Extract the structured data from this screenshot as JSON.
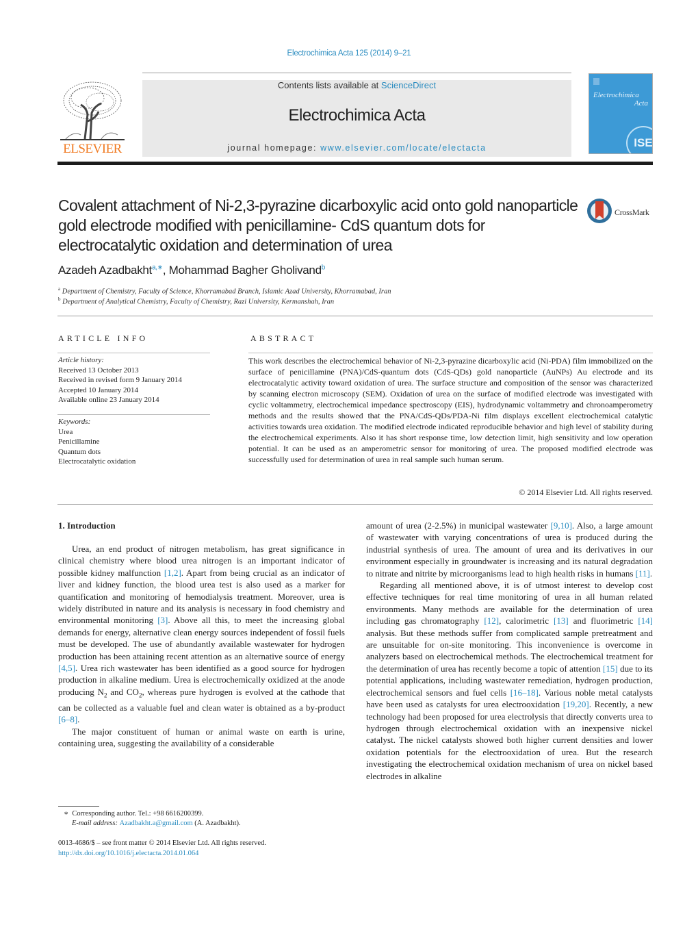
{
  "header": {
    "journal_ref": "Electrochimica Acta 125 (2014) 9–21",
    "contents_prefix": "Contents lists available at ",
    "contents_link": "ScienceDirect",
    "journal_title": "Electrochimica Acta",
    "homepage_prefix": "journal homepage: ",
    "homepage_link": "www.elsevier.com/locate/electacta",
    "publisher_logo": "ELSEVIER",
    "cover": {
      "title_line1": "Electrochimica",
      "title_line2": "Acta",
      "society_badge": "ISE"
    },
    "accent_color": "#2a8cc0",
    "logo_color": "#f07a22",
    "cover_color": "#3d9ad6"
  },
  "article": {
    "title": "Covalent attachment of Ni-2,3-pyrazine dicarboxylic acid onto gold nanoparticle gold electrode modified with penicillamine- CdS quantum dots for electrocatalytic oxidation and determination of urea",
    "crossmark": "CrossMark",
    "authors": [
      {
        "name": "Azadeh Azadbakht",
        "sup": "a,∗"
      },
      {
        "name": "Mohammad Bagher Gholivand",
        "sup": "b"
      }
    ],
    "author_separator": ", ",
    "affiliations": [
      {
        "sup": "a",
        "text": "Department of Chemistry, Faculty of Science, Khorramabad Branch, Islamic Azad University, Khorramabad, Iran"
      },
      {
        "sup": "b",
        "text": "Department of Analytical Chemistry, Faculty of Chemistry, Razi University, Kermanshah, Iran"
      }
    ]
  },
  "article_info": {
    "heading": "ARTICLE INFO",
    "history_label": "Article history:",
    "history": [
      "Received 13 October 2013",
      "Received in revised form 9 January 2014",
      "Accepted 10 January 2014",
      "Available online 23 January 2014"
    ],
    "keywords_label": "Keywords:",
    "keywords": [
      "Urea",
      "Penicillamine",
      "Quantum dots",
      "Electrocatalytic oxidation"
    ]
  },
  "abstract": {
    "heading": "ABSTRACT",
    "text": "This work describes the electrochemical behavior of Ni-2,3-pyrazine dicarboxylic acid (Ni-PDA) film immobilized on the surface of penicillamine (PNA)/CdS-quantum dots (CdS-QDs) gold nanoparticle (AuNPs) Au electrode and its electrocatalytic activity toward oxidation of urea. The surface structure and composition of the sensor was characterized by scanning electron microscopy (SEM). Oxidation of urea on the surface of modified electrode was investigated with cyclic voltammetry, electrochemical impedance spectroscopy (EIS), hydrodynamic voltammetry and chronoamperometry methods and the results showed that the PNA/CdS-QDs/PDA-Ni film displays excellent electrochemical catalytic activities towards urea oxidation. The modified electrode indicated reproducible behavior and high level of stability during the electrochemical experiments. Also it has short response time, low detection limit, high sensitivity and low operation potential. It can be used as an amperometric sensor for monitoring of urea. The proposed modified electrode was successfully used for determination of urea in real sample such human serum.",
    "copyright": "© 2014 Elsevier Ltd. All rights reserved."
  },
  "intro": {
    "heading": "1.  Introduction",
    "left_p1": [
      {
        "t": "Urea, an end product of nitrogen metabolism, has great significance in clinical chemistry where blood urea nitrogen is an important indicator of possible kidney malfunction "
      },
      {
        "ref": "[1,2]"
      },
      {
        "t": ". Apart from being crucial as an indicator of liver and kidney function, the blood urea test is also used as a marker for quantification and monitoring of hemodialysis treatment. Moreover, urea is widely distributed in nature and its analysis is necessary in food chemistry and environmental monitoring "
      },
      {
        "ref": "[3]"
      },
      {
        "t": ". Above all this, to meet the increasing global demands for energy, alternative clean energy sources independent of fossil fuels must be developed. The use of abundantly available wastewater for hydrogen production has been attaining recent attention as an alternative source of energy "
      },
      {
        "ref": "[4,5]"
      },
      {
        "t": ". Urea rich wastewater has been identified as a good source for hydrogen production in alkaline medium. Urea is electrochemically oxidized at the anode producing N"
      },
      {
        "sub": "2"
      },
      {
        "t": " and CO"
      },
      {
        "sub": "2"
      },
      {
        "t": ", whereas pure hydrogen is evolved at the cathode that can be collected as a valuable fuel and clean water is obtained as a by-product "
      },
      {
        "ref": "[6–8]"
      },
      {
        "t": "."
      }
    ],
    "left_p2": [
      {
        "t": "The major constituent of human or animal waste on earth is urine, containing urea, suggesting the availability of a considerable"
      }
    ],
    "right_p1": [
      {
        "t": "amount of urea (2-2.5%) in municipal wastewater "
      },
      {
        "ref": "[9,10]"
      },
      {
        "t": ". Also, a large amount of wastewater with varying concentrations of urea is produced during the industrial synthesis of urea. The amount of urea and its derivatives in our environment especially in groundwater is increasing and its natural degradation to nitrate and nitrite by microorganisms lead to high health risks in humans "
      },
      {
        "ref": "[11]"
      },
      {
        "t": "."
      }
    ],
    "right_p2": [
      {
        "t": "Regarding all mentioned above, it is of utmost interest to develop cost effective techniques for real time monitoring of urea in all human related environments. Many methods are available for the determination of urea including gas chromatography "
      },
      {
        "ref": "[12]"
      },
      {
        "t": ", calorimetric "
      },
      {
        "ref": "[13]"
      },
      {
        "t": " and fluorimetric "
      },
      {
        "ref": "[14]"
      },
      {
        "t": " analysis. But these methods suffer from complicated sample pretreatment and are unsuitable for on-site monitoring. This inconvenience is overcome in analyzers based on electrochemical methods. The electrochemical treatment for the determination of urea has recently become a topic of attention "
      },
      {
        "ref": "[15]"
      },
      {
        "t": " due to its potential applications, including wastewater remediation, hydrogen production, electrochemical sensors and fuel cells "
      },
      {
        "ref": "[16–18]"
      },
      {
        "t": ". Various noble metal catalysts have been used as catalysts for urea electrooxidation "
      },
      {
        "ref": "[19,20]"
      },
      {
        "t": ". Recently, a new technology had been proposed for urea electrolysis that directly converts urea to hydrogen through electrochemical oxidation with an inexpensive nickel catalyst. The nickel catalysts showed both higher current densities and lower oxidation potentials for the electrooxidation of urea. But the research investigating the electrochemical oxidation mechanism of urea on nickel based electrodes in alkaline"
      }
    ]
  },
  "footnotes": {
    "corresponding_marker": "∗",
    "corresponding": "Corresponding author. Tel.: +98 6616200399.",
    "email_label": "E-mail address: ",
    "email": "Azadbakht.a@gmail.com",
    "email_suffix": " (A. Azadbakht).",
    "issn_line": "0013-4686/$ – see front matter © 2014 Elsevier Ltd. All rights reserved.",
    "doi": "http://dx.doi.org/10.1016/j.electacta.2014.01.064"
  }
}
